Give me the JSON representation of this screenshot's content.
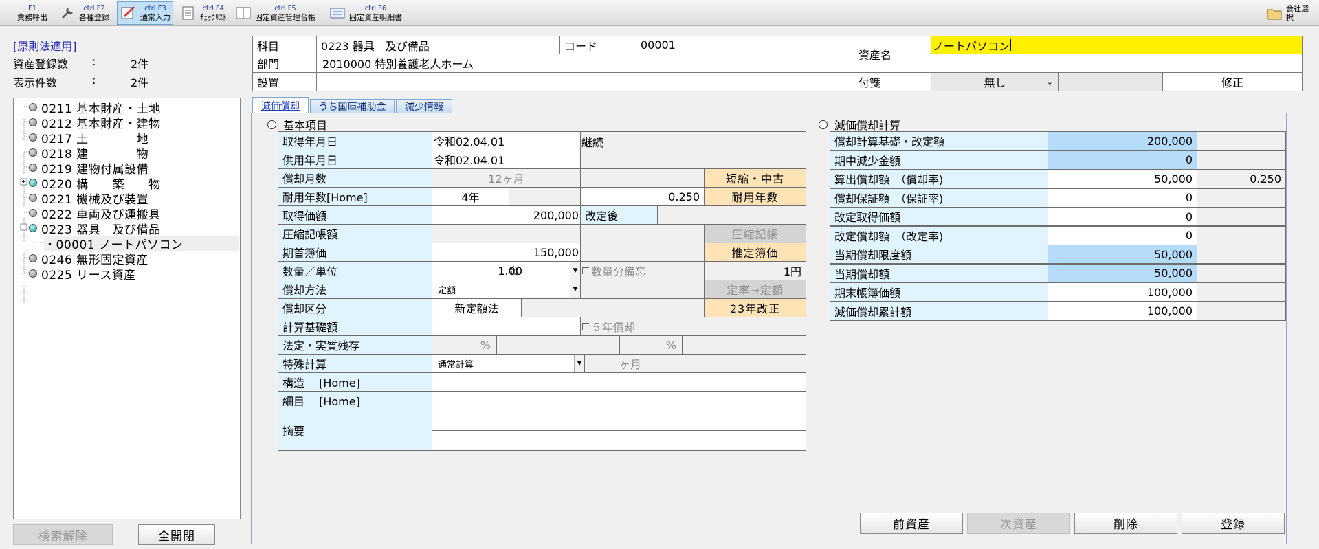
{
  "toolbar": [
    {
      "key": "F1",
      "label": "業務呼出",
      "icon": "home-icon"
    },
    {
      "key": "ctrl F2",
      "label": "各種登録",
      "icon": "tools-icon"
    },
    {
      "key": "ctrl F3",
      "label": "通常入力",
      "icon": "pen-edit-icon",
      "active": true
    },
    {
      "key": "ctrl F4",
      "label": "ﾁｪｯｸﾘｽﾄ",
      "icon": "list-icon"
    },
    {
      "key": "ctrl F5",
      "label": "固定資産管理台帳",
      "icon": "book-icon"
    },
    {
      "key": "ctrl F6",
      "label": "固定資産明細書",
      "icon": "form-icon"
    }
  ],
  "company_select": "会社選択",
  "left": {
    "mode": "[原則法適用]",
    "reg_count_label": "資産登録数",
    "reg_count_value": "2件",
    "disp_count_label": "表示件数",
    "disp_count_value": "2件",
    "colon": ":",
    "tree": [
      {
        "label": "0211 基本財産・土地"
      },
      {
        "label": "0212 基本財産・建物"
      },
      {
        "label": "0217 土　　　　地"
      },
      {
        "label": "0218 建　　　　物"
      },
      {
        "label": "0219 建物付属設備"
      },
      {
        "label": "0220 構　　築　　物"
      },
      {
        "label": "0221 機械及び装置"
      },
      {
        "label": "0222 車両及び運搬具"
      },
      {
        "label": "0223 器具　及び備品"
      },
      {
        "label": "・00001 ノートパソコン"
      },
      {
        "label": "0246 無形固定資産"
      },
      {
        "label": "0225 リース資産"
      }
    ],
    "search_clear": "検索解除",
    "expand_all": "全開閉"
  },
  "header": {
    "kamoku_label": "科目",
    "kamoku_value": "0223 器具　及び備品",
    "code_label": "コード",
    "code_value": "00001",
    "bumon_label": "部門",
    "bumon_value": "2010000 特別養護老人ホーム",
    "setchi_label": "設置",
    "setchi_value": "",
    "shisan_label": "資産名",
    "shisan_value": "ノートパソコン",
    "fusen_label": "付箋",
    "fusen_value": "無し",
    "modify": "修正"
  },
  "tabs": [
    "減価償却",
    "うち国庫補助金",
    "減少情報"
  ],
  "basic": {
    "title": "基本項目",
    "acq_label": "取得年月日",
    "acq_value": "令和02.04.01",
    "keizoku": "継続",
    "use_label": "供用年月日",
    "use_value": "令和02.04.01",
    "months_label": "償却月数",
    "months_value": "12ヶ月",
    "shorten_btn": "短縮・中古",
    "life_label": "耐用年数[Home]",
    "life_value": "4年",
    "life_rate": "0.250",
    "life_btn": "耐用年数",
    "cost_label": "取得価額",
    "cost_value": "200,000",
    "after_label": "改定後",
    "compress_label": "圧縮記帳額",
    "compress_btn": "圧縮記帳",
    "begin_label": "期首簿価",
    "begin_value": "150,000",
    "est_btn": "推定簿価",
    "qty_label": "数量／単位",
    "qty_value": "1.00",
    "unit_value": "台",
    "memo_label": "数量分備忘",
    "one_yen": "1円",
    "method_label": "償却方法",
    "method_value": "定額",
    "fixed_btn": "定率→定額",
    "kubun_label": "償却区分",
    "kubun_value": "新定額法",
    "kaisei_btn": "23年改正",
    "base_label": "計算基礎額",
    "five_label": "５年償却",
    "residual_label": "法定・実質残存",
    "pct": "%",
    "special_label": "特殊計算",
    "special_value": "通常計算",
    "month_unit": "ヶ月",
    "struct_label": "構造　 [Home]",
    "detail_label": "細目　 [Home]",
    "memo2_label": "摘要"
  },
  "calc": {
    "title": "減価償却計算",
    "rows": [
      {
        "label": "償却計算基礎・改定額",
        "value": "200,000",
        "blue": true,
        "extra": ""
      },
      {
        "label": "期中減少金額",
        "value": "0",
        "blue": true,
        "extra": ""
      },
      {
        "label": "算出償却額　（償却率)",
        "value": "50,000",
        "blue": false,
        "extra": "0.250"
      },
      {
        "label": "償却保証額　（保証率)",
        "value": "0",
        "blue": false,
        "extra": ""
      },
      {
        "label": "改定取得価額",
        "value": "0",
        "blue": false,
        "extra": ""
      },
      {
        "label": "改定償却額　（改定率)",
        "value": "0",
        "blue": false,
        "extra": ""
      },
      {
        "label": "当期償却限度額",
        "value": "50,000",
        "blue": true,
        "extra": ""
      },
      {
        "label": "当期償却額",
        "value": "50,000",
        "blue": true,
        "extra": ""
      },
      {
        "label": "期末帳簿価額",
        "value": "100,000",
        "blue": false,
        "extra": ""
      },
      {
        "label": "減価償却累計額",
        "value": "100,000",
        "blue": false,
        "extra": ""
      }
    ]
  },
  "buttons": {
    "prev": "前資産",
    "next": "次資産",
    "delete": "削除",
    "register": "登録"
  }
}
